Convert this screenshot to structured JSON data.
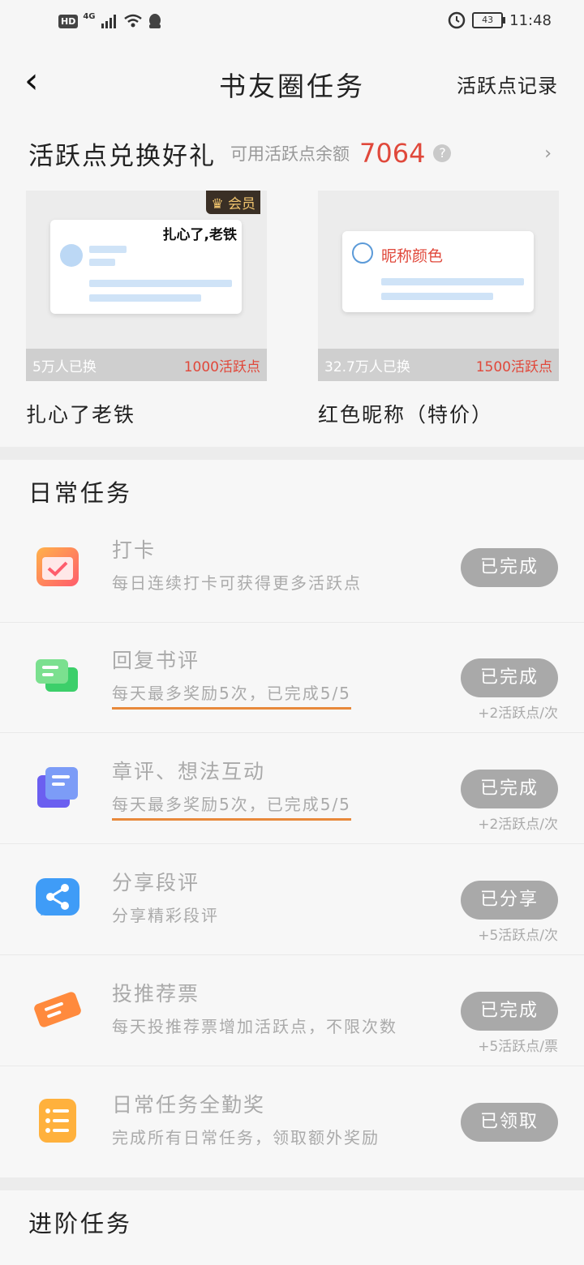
{
  "status_bar": {
    "hd": "HD",
    "network": "4G",
    "battery": "43",
    "time": "11:48"
  },
  "header": {
    "title": "书友圈任务",
    "record_link": "活跃点记录"
  },
  "exchange": {
    "title": "活跃点兑换好礼",
    "balance_label": "可用活跃点余额",
    "balance": "7064",
    "help": "?",
    "arrow": "›",
    "items": [
      {
        "badge": "会员",
        "preview_text": "扎心了,老铁",
        "exchanged": "5万人已换",
        "cost": "1000活跃点",
        "name": "扎心了老铁"
      },
      {
        "preview_text": "昵称颜色",
        "exchanged": "32.7万人已换",
        "cost": "1500活跃点",
        "name": "红色昵称（特价）"
      }
    ]
  },
  "daily": {
    "title": "日常任务",
    "tasks": [
      {
        "name": "打卡",
        "desc": "每日连续打卡可获得更多活跃点",
        "button": "已完成",
        "reward": ""
      },
      {
        "name": "回复书评",
        "desc": "每天最多奖励5次，已完成5/5",
        "button": "已完成",
        "reward": "+2活跃点/次"
      },
      {
        "name": "章评、想法互动",
        "desc": "每天最多奖励5次，已完成5/5",
        "button": "已完成",
        "reward": "+2活跃点/次"
      },
      {
        "name": "分享段评",
        "desc": "分享精彩段评",
        "button": "已分享",
        "reward": "+5活跃点/次"
      },
      {
        "name": "投推荐票",
        "desc": "每天投推荐票增加活跃点，不限次数",
        "button": "已完成",
        "reward": "+5活跃点/票"
      },
      {
        "name": "日常任务全勤奖",
        "desc": "完成所有日常任务，领取额外奖励",
        "button": "已领取",
        "reward": ""
      }
    ]
  },
  "advanced": {
    "title": "进阶任务"
  },
  "colors": {
    "accent_red": "#e0483b",
    "button_gray": "#a9a9a9",
    "progress_orange": "#e8893b"
  }
}
